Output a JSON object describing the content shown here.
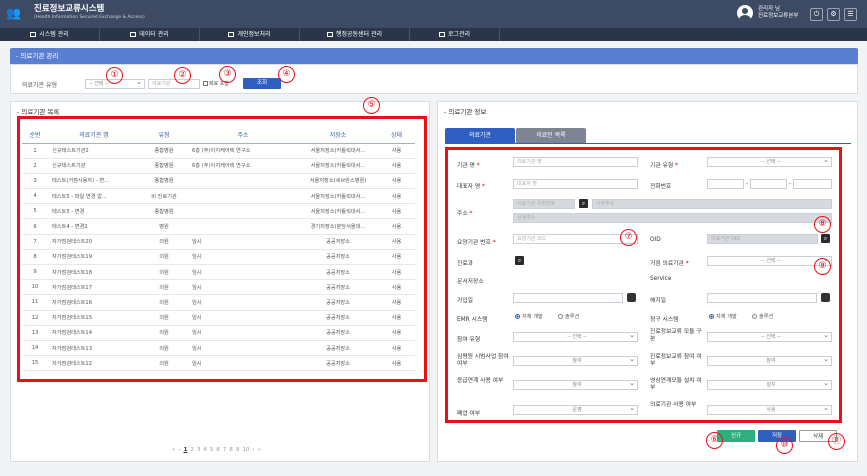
{
  "header": {
    "title": "진료정보교류시스템",
    "subtitle": "(Health Information Secured Exchange & Access)",
    "user_name": "관리자 님",
    "user_org": "진료정보교류본부"
  },
  "menu": [
    {
      "label": "시스템 관리"
    },
    {
      "label": "데이터 관리"
    },
    {
      "label": "개인정보처리"
    },
    {
      "label": "행정공동센터 관리"
    },
    {
      "label": "로그관리"
    }
  ],
  "page_title": "- 의료기관 관리",
  "search": {
    "type_label": "의료기관 유형",
    "type_value": "-- 선택 --",
    "name_placeholder": "의료기관",
    "closed_label": "폐료 포함",
    "search_button": "조회"
  },
  "list": {
    "title": "- 의료기관 목록",
    "columns": [
      "순번",
      "의료기관 명",
      "유형",
      "주소",
      "저장소",
      "상태"
    ],
    "rows": [
      [
        "1",
        "신규테스트기관2",
        "종합병원",
        "6층 (주)이지케어텍 연구소",
        "서울저장소(카톨릭대서...",
        "사용"
      ],
      [
        "2",
        "신규테스트기관",
        "종합병원",
        "6층 (주)이지케어텍 연구소",
        "서울저장소(카톨릭대서...",
        "사용"
      ],
      [
        "3",
        "테스트(거점사용자) - 변...",
        "종합병원",
        "",
        "서울저장소(세브란스병원)",
        "사용"
      ],
      [
        "4",
        "테스트5 - 파일 변경 없...",
        "비 진료기관",
        "",
        "서울저장소(카톨릭대서...",
        "사용"
      ],
      [
        "5",
        "테스트5 - 변경",
        "종합병원",
        "",
        "서울저장소(카톨릭대서...",
        "사용"
      ],
      [
        "6",
        "테스트4 - 변경2",
        "병원",
        "",
        "경기저장소(분당서울대...",
        "사용"
      ],
      [
        "7",
        "자가점검테스트20",
        "의원",
        "임시",
        "공공저장소",
        "사용"
      ],
      [
        "8",
        "자가점검테스트19",
        "의원",
        "임시",
        "공공저장소",
        "사용"
      ],
      [
        "9",
        "자가점검테스트18",
        "의원",
        "임시",
        "공공저장소",
        "사용"
      ],
      [
        "10",
        "자가점검테스트17",
        "의원",
        "임시",
        "공공저장소",
        "사용"
      ],
      [
        "11",
        "자가점검테스트16",
        "의원",
        "임시",
        "공공저장소",
        "사용"
      ],
      [
        "12",
        "자가점검테스트15",
        "의원",
        "임시",
        "공공저장소",
        "사용"
      ],
      [
        "13",
        "자가점검테스트14",
        "의원",
        "임시",
        "공공저장소",
        "사용"
      ],
      [
        "14",
        "자가점검테스트13",
        "의원",
        "임시",
        "공공저장소",
        "사용"
      ],
      [
        "15",
        "자가점검테스트12",
        "의원",
        "임시",
        "공공저장소",
        "사용"
      ]
    ],
    "pager": [
      "«",
      "‹",
      "1",
      "2",
      "3",
      "4",
      "5",
      "6",
      "7",
      "8",
      "9",
      "10",
      "›",
      "»"
    ]
  },
  "info": {
    "title": "- 의료기관 정보",
    "tab_org": "의료기관",
    "tab_doctor": "의료인 목록",
    "labels": {
      "name": "기관 명",
      "type": "기관 유형",
      "rep": "대표자 명",
      "phone": "전화번호",
      "address": "주소",
      "code": "요양기관 번호",
      "oid": "OID",
      "dept": "진료과",
      "hub": "거점 의료기관",
      "repo": "문서저장소",
      "service": "Service",
      "join": "가입일",
      "leave": "해지일",
      "emr": "EMR 시스템",
      "claim": "청구 시스템",
      "participation": "참여 유형",
      "module_type": "진료정보교류 모듈 구분",
      "pilot": "심평원 시범사업 참여 여부",
      "module_part": "진료정보교류 참여 여부",
      "emergency": "응급연계 사용 여부",
      "video": "영상연계모듈 설치 여부",
      "closed": "폐업 여부",
      "org_use": "의료기관 사용 여부"
    },
    "placeholders": {
      "name": "의료기관 명",
      "rep": "대표자 명",
      "zip": "의료기관 우편번호",
      "addr1": "기본주소",
      "addr2": "상세주소",
      "code": "요양기관 코드",
      "oid": "의료기관 OID"
    },
    "values": {
      "type": "-- 선택 --",
      "hub": "-- 선택 --",
      "participation": "-- 선택 --",
      "module_type": "-- 선택 --",
      "pilot": "참여",
      "module_part": "참여",
      "emergency": "참여",
      "video": "설치",
      "closed": "운영",
      "org_use": "사용",
      "phone_sep": "-"
    },
    "radio": {
      "self": "자체 개발",
      "solution": "솔루션"
    }
  },
  "actions": {
    "new": "신규",
    "save": "저장",
    "delete": "삭제"
  },
  "markers": [
    "①",
    "②",
    "③",
    "④",
    "⑤",
    "⑥",
    "⑦",
    "⑧",
    "⑨",
    "⑩",
    "⑪"
  ],
  "colors": {
    "header": "#3c4a63",
    "accent": "#2f5fc0",
    "highlight": "#e8111a",
    "new": "#2eaf7d"
  }
}
